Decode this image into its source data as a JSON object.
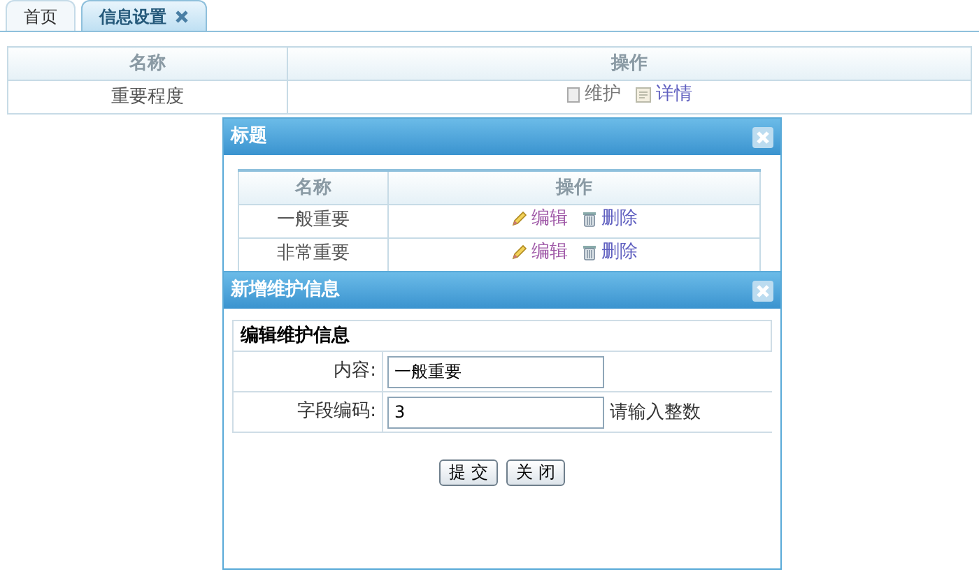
{
  "tabs": [
    {
      "label": "首页",
      "selected": false,
      "closable": false
    },
    {
      "label": "信息设置",
      "selected": true,
      "closable": true
    }
  ],
  "table": {
    "columns": [
      "名称",
      "操作"
    ],
    "rows": [
      {
        "name": "重要程度",
        "actions": [
          {
            "kind": "maintain",
            "label": "维护"
          },
          {
            "kind": "details",
            "label": "详情"
          }
        ]
      }
    ]
  },
  "dialogs": [
    {
      "kind": "list",
      "title": "标题",
      "columns": [
        "名称",
        "操作"
      ],
      "rows": [
        {
          "name": "一般重要",
          "actions": [
            {
              "kind": "edit",
              "label": "编辑"
            },
            {
              "kind": "delete",
              "label": "删除"
            }
          ]
        },
        {
          "name": "非常重要",
          "actions": [
            {
              "kind": "edit",
              "label": "编辑"
            },
            {
              "kind": "delete",
              "label": "删除"
            }
          ]
        }
      ]
    },
    {
      "kind": "form",
      "title": "新增维护信息",
      "section_title": "编辑维护信息",
      "fields": [
        {
          "label": "内容:",
          "value": "一般重要"
        },
        {
          "label": "字段编码:",
          "value": "3",
          "hint": "请输入整数"
        }
      ],
      "buttons": [
        "提 交",
        "关 闭"
      ]
    }
  ]
}
